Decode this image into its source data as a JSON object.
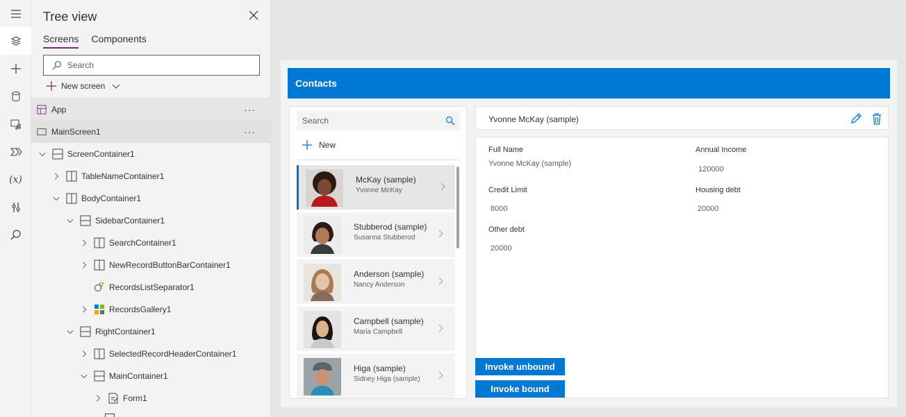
{
  "tree_panel": {
    "title": "Tree view",
    "tabs": [
      {
        "label": "Screens",
        "active": true
      },
      {
        "label": "Components",
        "active": false
      }
    ],
    "search_placeholder": "Search",
    "new_screen_label": "New screen",
    "rows": [
      {
        "label": "App"
      },
      {
        "label": "MainScreen1"
      },
      {
        "label": "ScreenContainer1"
      },
      {
        "label": "TableNameContainer1"
      },
      {
        "label": "BodyContainer1"
      },
      {
        "label": "SidebarContainer1"
      },
      {
        "label": "SearchContainer1"
      },
      {
        "label": "NewRecordButtonBarContainer1"
      },
      {
        "label": "RecordsListSeparator1"
      },
      {
        "label": "RecordsGallery1"
      },
      {
        "label": "RightContainer1"
      },
      {
        "label": "SelectedRecordHeaderContainer1"
      },
      {
        "label": "MainContainer1"
      },
      {
        "label": "Form1"
      }
    ],
    "more_glyph": "···"
  },
  "app": {
    "header_title": "Contacts",
    "search_placeholder": "Search",
    "new_label": "New",
    "records": [
      {
        "name": "McKay (sample)",
        "sub": "Yvonne McKay",
        "selected": true
      },
      {
        "name": "Stubberod (sample)",
        "sub": "Susanna Stubberod",
        "selected": false
      },
      {
        "name": "Anderson (sample)",
        "sub": "Nancy Anderson",
        "selected": false
      },
      {
        "name": "Campbell (sample)",
        "sub": "Maria Campbell",
        "selected": false
      },
      {
        "name": "Higa (sample)",
        "sub": "Sidney Higa (sample)",
        "selected": false
      }
    ],
    "selected_header": "Yvonne McKay (sample)",
    "form": {
      "full_name_label": "Full Name",
      "full_name_value": "Yvonne McKay (sample)",
      "annual_income_label": "Annual Income",
      "annual_income_value": "120000",
      "credit_limit_label": "Credit Limit",
      "credit_limit_value": "8000",
      "housing_debt_label": "Housing debt",
      "housing_debt_value": "20000",
      "other_debt_label": "Other debt",
      "other_debt_value": "20000"
    },
    "invoke_unbound_label": "Invoke unbound",
    "invoke_bound_label": "Invoke bound"
  },
  "colors": {
    "accent": "#0078d4",
    "tab_underline": "#742774"
  }
}
